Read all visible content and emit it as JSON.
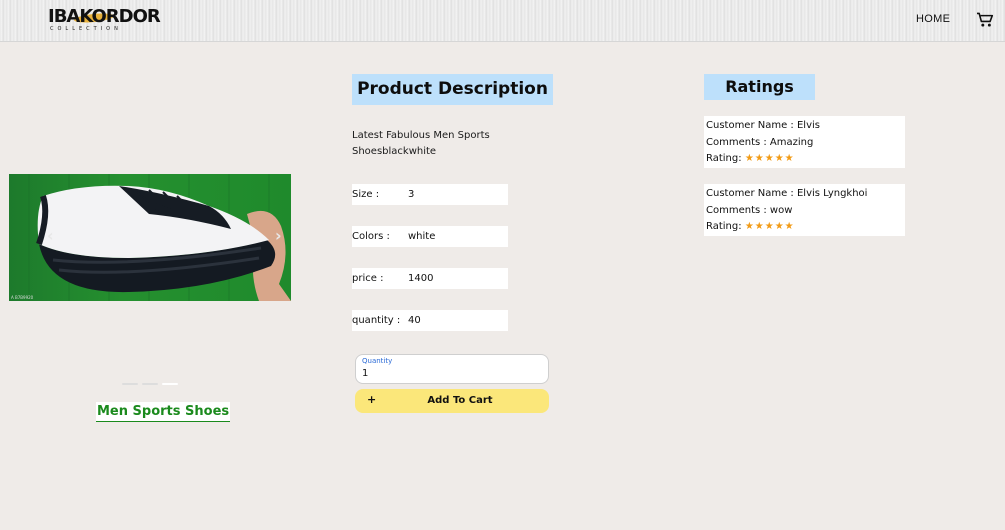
{
  "header": {
    "logo_text": "IBAKORDOR",
    "logo_subtext": "COLLECTION",
    "nav_home": "HOME",
    "cart_icon": "shopping-cart-icon"
  },
  "product": {
    "name": "Men Sports Shoes",
    "carousel_prev_icon": "chevron-left-icon",
    "carousel_next_icon": "chevron-right-icon",
    "carousel_slides": 3,
    "carousel_active_index": 2
  },
  "description": {
    "heading": "Product Description",
    "text": "Latest Fabulous Men Sports Shoesblackwhite",
    "specs": [
      {
        "label": "Size :",
        "value": "3"
      },
      {
        "label": "Colors :",
        "value": "white"
      },
      {
        "label": "price :",
        "value": "1400"
      },
      {
        "label": "quantity :",
        "value": "40"
      }
    ]
  },
  "cart_form": {
    "quantity_label": "Quantity",
    "quantity_value": "1",
    "add_button_icon": "+",
    "add_button_label": "Add To Cart"
  },
  "ratings": {
    "heading": "Ratings",
    "reviews": [
      {
        "customer_line": "Customer Name : Elvis",
        "comment_line": "Comments : Amazing",
        "rating_label": "Rating:",
        "stars": "★★★★★",
        "rating": 5
      },
      {
        "customer_line": "Customer Name : Elvis Lyngkhoi",
        "comment_line": "Comments : wow",
        "rating_label": "Rating:",
        "stars": "★★★★★",
        "rating": 5
      }
    ]
  },
  "colors": {
    "background": "#efebe8",
    "heading_bg": "#bde0fb",
    "add_button_bg": "#fbe77a",
    "product_name_color": "#1b8a1d",
    "star_color": "#f29b16"
  }
}
